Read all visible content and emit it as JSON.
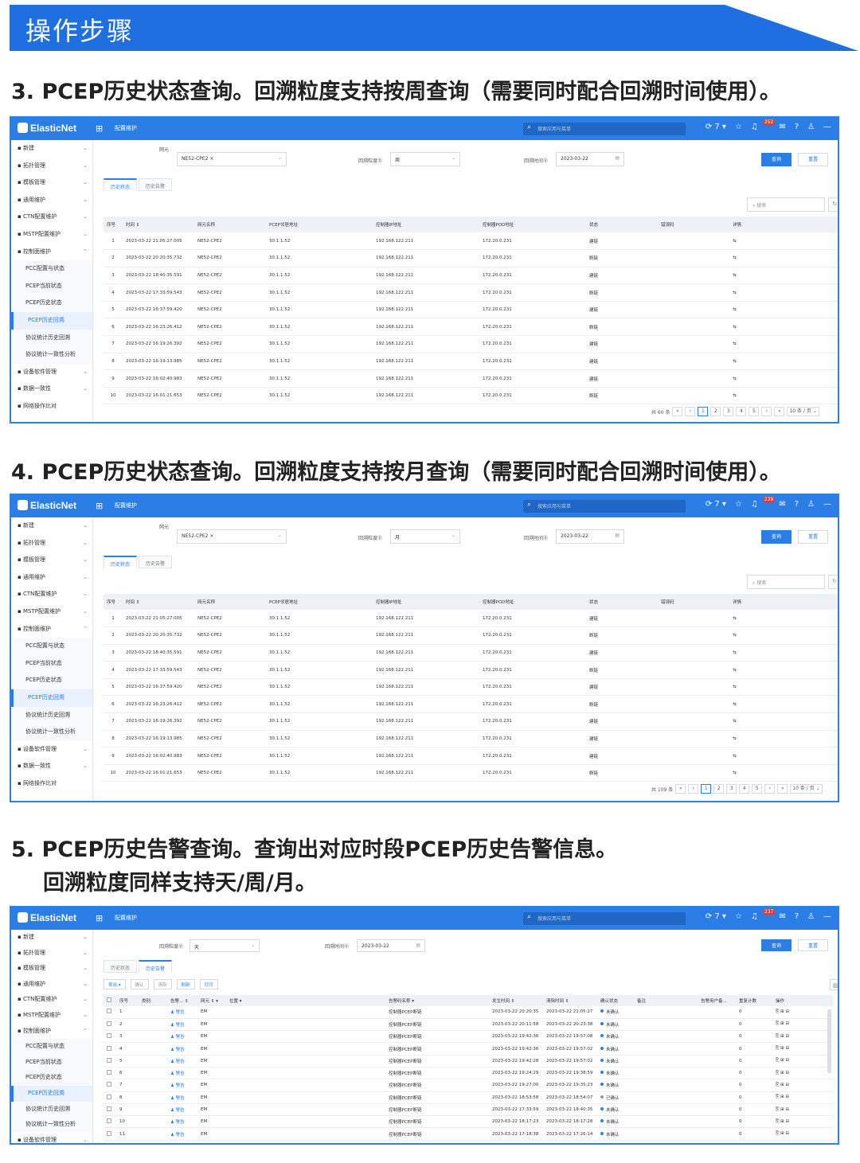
{
  "banner": {
    "title": "操作步骤"
  },
  "sections": [
    {
      "text": "3.  PCEP历史状态查询。回溯粒度支持按周查询（需要同时配合回溯时间使用）。"
    },
    {
      "text": "4.  PCEP历史状态查询。回溯粒度支持按月查询（需要同时配合回溯时间使用）。"
    },
    {
      "text": "5.  PCEP历史告警查询。查询出对应时段PCEP历史告警信息。",
      "text2": "回溯粒度同样支持天/周/月。"
    }
  ],
  "app": {
    "logo": "ElasticNet",
    "app_name": "配置维护",
    "search_placeholder": "搜索应用与菜单",
    "count_label": "7",
    "sidebar": [
      {
        "label": "新建",
        "arrow": "⌄"
      },
      {
        "label": "拓扑管理",
        "arrow": "⌄"
      },
      {
        "label": "模板管理",
        "arrow": "⌄"
      },
      {
        "label": "通用维护",
        "arrow": "⌄"
      },
      {
        "label": "CTN配置维护",
        "arrow": "⌄"
      },
      {
        "label": "MSTP配置维护",
        "arrow": "⌄"
      },
      {
        "label": "控制面维护",
        "arrow": "⌃"
      },
      {
        "label": "PCC配置与状态",
        "sub": true
      },
      {
        "label": "PCEP当前状态",
        "sub": true
      },
      {
        "label": "PCEP历史状态",
        "sub": true
      },
      {
        "label": "PCEP历史回溯",
        "sub": true,
        "active": true
      },
      {
        "label": "协议统计历史回溯",
        "sub": true
      },
      {
        "label": "协议统计一致性分析",
        "sub": true
      },
      {
        "label": "设备软件管理",
        "arrow": "⌄"
      },
      {
        "label": "数据一致性",
        "arrow": "⌄"
      },
      {
        "label": "网络操作比对",
        "arrow": ""
      }
    ],
    "filters": {
      "ne_label": "网元",
      "ne_value": "NE52-CPE2",
      "granularity_label": "回溯粒度⓪",
      "time_label": "回溯时间⓪",
      "time_value": "2023-03-22",
      "query_btn": "查询",
      "reset_btn": "重置"
    },
    "tabs": [
      "历史状态",
      "历史告警"
    ],
    "search_box": "搜索",
    "status_columns": [
      "序号",
      "时间 ⇕",
      "网元名称",
      "PCEP邻居地址",
      "控制器IP地址",
      "控制器POD地址",
      "状态",
      "错误码",
      "详情"
    ],
    "status_rows": [
      [
        "1",
        "2023-03-22 21:05:27.005",
        "NE52-CPE2",
        "30.1.1.52",
        "192.168.122.211",
        "172.20.0.231",
        "建链",
        "",
        "⇆"
      ],
      [
        "2",
        "2023-03-22 20:20:35.732",
        "NE52-CPE2",
        "30.1.1.52",
        "192.168.122.211",
        "172.20.0.231",
        "断链",
        "",
        "⇆"
      ],
      [
        "3",
        "2023-03-22 18:40:35.591",
        "NE52-CPE2",
        "30.1.1.52",
        "192.168.122.211",
        "172.20.0.231",
        "建链",
        "",
        "⇆"
      ],
      [
        "4",
        "2023-03-22 17:33:59.543",
        "NE52-CPE2",
        "30.1.1.52",
        "192.168.122.211",
        "172.20.0.231",
        "断链",
        "",
        "⇆"
      ],
      [
        "5",
        "2023-03-22 16:37:59.420",
        "NE52-CPE2",
        "30.1.1.52",
        "192.168.122.211",
        "172.20.0.231",
        "建链",
        "",
        "⇆"
      ],
      [
        "6",
        "2023-03-22 16:23:26.412",
        "NE52-CPE2",
        "30.1.1.52",
        "192.168.122.211",
        "172.20.0.231",
        "断链",
        "",
        "⇆"
      ],
      [
        "7",
        "2023-03-22 16:19:26.392",
        "NE52-CPE2",
        "30.1.1.52",
        "192.168.122.211",
        "172.20.0.231",
        "建链",
        "",
        "⇆"
      ],
      [
        "8",
        "2023-03-22 16:19:13.985",
        "NE52-CPE2",
        "30.1.1.52",
        "192.168.122.211",
        "172.20.0.231",
        "建链",
        "",
        "⇆"
      ],
      [
        "9",
        "2023-03-22 16:02:40.983",
        "NE52-CPE2",
        "30.1.1.52",
        "192.168.122.211",
        "172.20.0.231",
        "建链",
        "",
        "⇆"
      ],
      [
        "10",
        "2023-03-22 16:01:21.653",
        "NE52-CPE2",
        "30.1.1.52",
        "192.168.122.211",
        "172.20.0.231",
        "断链",
        "",
        "⇆"
      ]
    ],
    "pager_pages": [
      "1",
      "2",
      "3",
      "4",
      "5"
    ],
    "page_size": "10 条 / 页",
    "alarm_toolbar": [
      "导出 ▾",
      "确认",
      "清除",
      "刷新",
      "打印"
    ],
    "alarm_columns": [
      "",
      "序号",
      "类别",
      "告警... ⇕",
      "网元 ⇕ ▾",
      "位置 ▾",
      "告警码名称 ▾",
      "发生时间 ⇕",
      "清除时间 ⇕",
      "确认状态",
      "备注",
      "告警用户备...",
      "重复计数",
      "操作"
    ],
    "alarm_rows": [
      [
        "1",
        "2023-03-22 20:20:35",
        "2023-03-22 21:05:27",
        "未确认"
      ],
      [
        "2",
        "2023-03-22 20:11:58",
        "2023-03-22 20:23:38",
        "未确认"
      ],
      [
        "3",
        "2023-03-22 19:42:36",
        "2023-03-22 19:57:08",
        "未确认"
      ],
      [
        "4",
        "2023-03-22 19:42:36",
        "2023-03-22 19:57:02",
        "未确认"
      ],
      [
        "5",
        "2023-03-22 19:42:28",
        "2023-03-22 19:57:02",
        "未确认"
      ],
      [
        "6",
        "2023-03-22 19:24:29",
        "2023-03-22 19:38:59",
        "未确认"
      ],
      [
        "7",
        "2023-03-22 19:27:00",
        "2023-03-22 19:35:23",
        "未确认"
      ],
      [
        "8",
        "2023-03-22 18:53:58",
        "2023-03-22 18:54:07",
        "已确认"
      ],
      [
        "9",
        "2023-03-22 17:33:59",
        "2023-03-22 18:40:35",
        "未确认"
      ],
      [
        "10",
        "2023-03-22 18:17:23",
        "2023-03-22 18:17:28",
        "未确认"
      ],
      [
        "11",
        "2023-03-22 17:18:38",
        "2023-03-22 17:26:14",
        "未确认"
      ]
    ],
    "alarm_common": {
      "severity": "警告",
      "ne": "EM",
      "name": "控制器PCEP断链",
      "count": "0",
      "ops": "⎘ ⊞ ⊟"
    }
  },
  "shots": [
    {
      "granularity": "周",
      "total": "共 60 条",
      "bell_badge": "252"
    },
    {
      "granularity": "月",
      "total": "共 109 条",
      "bell_badge": "239"
    },
    {
      "granularity": "天",
      "bell_badge": "237"
    }
  ],
  "colors": {
    "banner": "#1f6fe0",
    "accent": "#2b7ee6"
  }
}
